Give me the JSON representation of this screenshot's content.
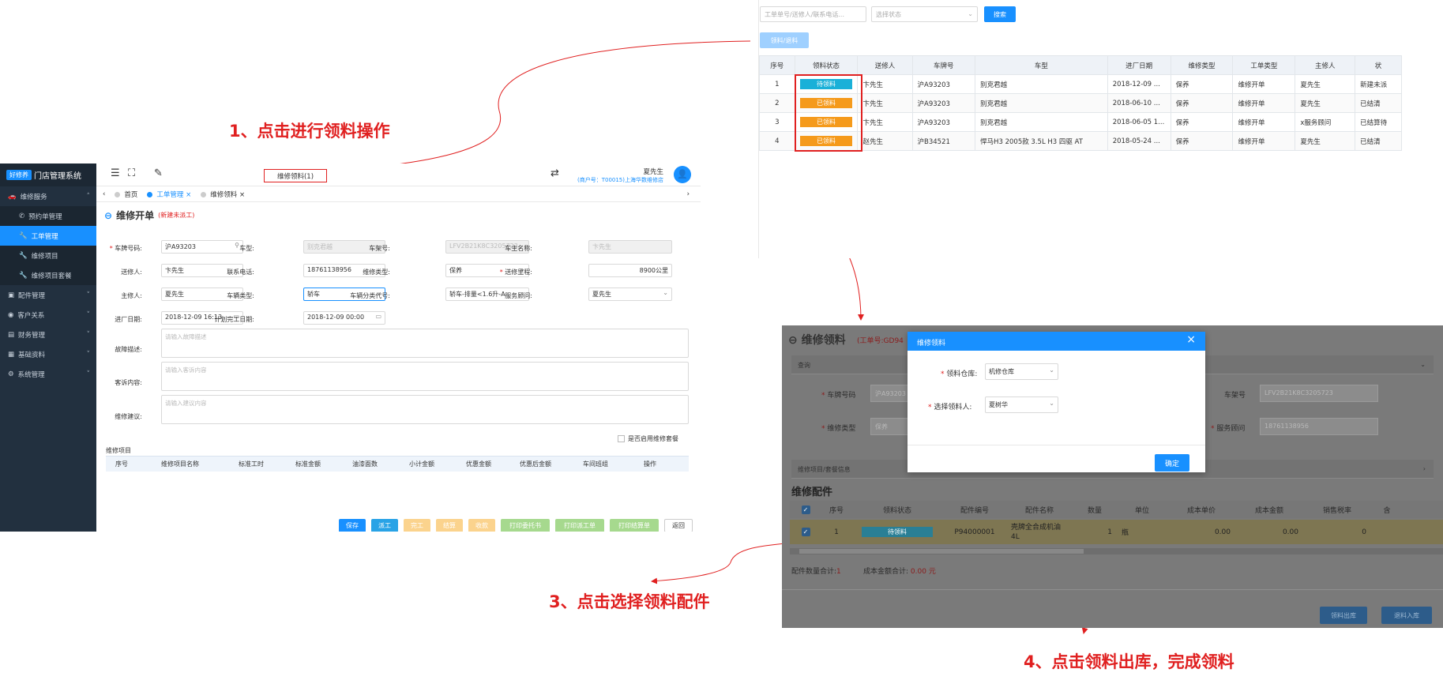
{
  "annotations": {
    "step1": "1、点击进行领料操作",
    "step3": "3、点击选择领料配件",
    "step4": "4、点击领料出库，完成领料"
  },
  "store": {
    "logo_mark": "好修养",
    "app_name": "门店管理系统",
    "sidebar": {
      "items": [
        {
          "label": "维修服务"
        },
        {
          "label": "预约单管理"
        },
        {
          "label": "工单管理"
        },
        {
          "label": "维修项目"
        },
        {
          "label": "维修项目套餐"
        },
        {
          "label": "配件管理"
        },
        {
          "label": "客户关系"
        },
        {
          "label": "财务管理"
        },
        {
          "label": "基础资料"
        },
        {
          "label": "系统管理"
        }
      ]
    },
    "header": {
      "repair_pick_tab": "维修领料(1)",
      "user_name": "夏先生",
      "user_org": "(商户号：T00015)上海华数维修店"
    },
    "tabs": [
      "首页",
      "工单管理",
      "维修领料"
    ],
    "page": {
      "title": "维修开单",
      "status": "(新建未派工)"
    },
    "fields": {
      "plate_label": "车牌号码:",
      "plate_value": "沪A93203",
      "model_label": "车型:",
      "model_value": "别克君越",
      "vin_label": "车架号:",
      "vin_value": "LFV2B21K8C3205723",
      "owner_label": "车主名称:",
      "owner_value": "卞先生",
      "sender_label": "送修人:",
      "sender_value": "卞先生",
      "phone_label": "联系电话:",
      "phone_value": "18761138956",
      "repair_type_label": "维修类型:",
      "repair_type_value": "保养",
      "mileage_label": "送修里程:",
      "mileage_value": "8900公里",
      "technician_label": "主修人:",
      "technician_value": "夏先生",
      "vehicle_type_label": "车辆类型:",
      "vehicle_type_value": "轿车",
      "vehicle_class_label": "车辆分类代号:",
      "vehicle_class_value": "轿车-排量<1.6升-A",
      "advisor_label": "服务顾问:",
      "advisor_value": "夏先生",
      "entry_date_label": "进厂日期:",
      "entry_date_value": "2018-12-09 16:13",
      "finish_date_label": "计划完工日期:",
      "finish_date_value": "2018-12-09 00:00",
      "fault_label": "故障描述:",
      "fault_placeholder": "请输入故障描述",
      "complaint_label": "客诉内容:",
      "complaint_placeholder": "请输入客诉内容",
      "advice_label": "维修建议:",
      "advice_placeholder": "请输入建议内容",
      "package_check": "是否启用维修套餐"
    },
    "items_section": "维修项目",
    "items_columns": [
      "序号",
      "维修项目名称",
      "标准工时",
      "标准金额",
      "油漆面数",
      "小计金额",
      "优惠金额",
      "优惠后金额",
      "车间班组",
      "操作"
    ],
    "buttons": [
      "保存",
      "派工",
      "完工",
      "结算",
      "收款",
      "打印委托书",
      "打印派工单",
      "打印结算单",
      "返回"
    ],
    "colors": {
      "sidebar": "#22303f",
      "primary": "#1890ff",
      "annotation": "#e02020"
    }
  },
  "orders": {
    "search_placeholder": "工单单号/送修人/联系电话...",
    "status_placeholder": "选择状态",
    "search_button": "搜索",
    "pick_button": "领料/退料",
    "columns": [
      "序号",
      "领料状态",
      "送修人",
      "车牌号",
      "车型",
      "进厂日期",
      "维修类型",
      "工单类型",
      "主修人",
      "状"
    ],
    "rows": [
      [
        "1",
        "待领料",
        "卞先生",
        "沪A93203",
        "别克君越",
        "2018-12-09 ...",
        "保养",
        "维修开单",
        "夏先生",
        "新建未派"
      ],
      [
        "2",
        "已领料",
        "卞先生",
        "沪A93203",
        "别克君越",
        "2018-06-10 ...",
        "保养",
        "维修开单",
        "夏先生",
        "已结清"
      ],
      [
        "3",
        "已领料",
        "卞先生",
        "沪A93203",
        "别克君越",
        "2018-06-05 1...",
        "保养",
        "维修开单",
        "x服务顾问",
        "已结算待"
      ],
      [
        "4",
        "已领料",
        "赵先生",
        "沪B34521",
        "悍马H3 2005款 3.5L H3 四驱 AT",
        "2018-05-24 ...",
        "保养",
        "维修开单",
        "夏先生",
        "已结清"
      ]
    ]
  },
  "pick": {
    "page_title": "维修领料",
    "order_no": "(工单号:GD94",
    "query_label": "查询",
    "plate_label": "车牌号码",
    "plate_value": "沪A93203",
    "vin_label": "车架号",
    "vin_value": "LFV2B21K8C3205723",
    "repair_type_label": "维修类型",
    "repair_type_value": "保养",
    "advisor_label": "服务顾问",
    "advisor_value": "18761138956",
    "bar_label": "维修项目/套餐信息",
    "section": "维修配件",
    "columns": [
      "序号",
      "领料状态",
      "配件编号",
      "配件名称",
      "数量",
      "单位",
      "成本单价",
      "成本金额",
      "销售税率",
      "含"
    ],
    "row": {
      "index": "1",
      "status": "待领料",
      "code": "P94000001",
      "name_line1": "壳牌全合成机油",
      "name_line2": "4L",
      "qty": "1",
      "unit": "瓶",
      "cost_price": "0.00",
      "cost_amount": "0.00",
      "tax": "0"
    },
    "summary_qty_label": "配件数量合计:",
    "summary_qty": "1",
    "summary_cost_label": "成本金额合计:",
    "summary_cost": "0.00 元",
    "out_button": "领料出库",
    "return_button": "退料入库",
    "dialog": {
      "title": "维修领料",
      "warehouse_label": "领料仓库:",
      "warehouse_value": "机修仓库",
      "picker_label": "选择领料人:",
      "picker_value": "夏树华",
      "confirm": "确定"
    }
  }
}
